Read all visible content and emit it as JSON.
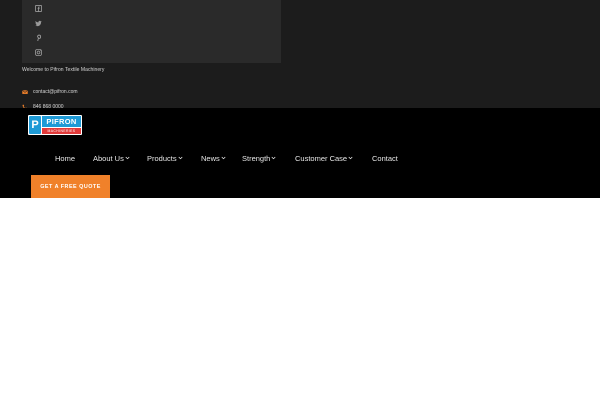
{
  "header": {
    "social": [
      {
        "icon": "facebook-icon"
      },
      {
        "icon": "twitter-icon"
      },
      {
        "icon": "pinterest-icon"
      },
      {
        "icon": "instagram-icon"
      }
    ],
    "welcome_text": "Welcome to Pifron Textile Machinery",
    "email": "contact@pifron.com",
    "phone": "846 868 0000",
    "accent_color": "#f0812a"
  },
  "logo": {
    "mark": "P",
    "name": "PIFRON",
    "tagline": "MACHINERIES"
  },
  "nav": {
    "items": [
      {
        "label": "Home",
        "has_dropdown": false
      },
      {
        "label": "About Us",
        "has_dropdown": true
      },
      {
        "label": "Products",
        "has_dropdown": true
      },
      {
        "label": "News",
        "has_dropdown": true
      },
      {
        "label": "Strength",
        "has_dropdown": true
      },
      {
        "label": "Customer Case",
        "has_dropdown": true
      },
      {
        "label": "Contact",
        "has_dropdown": false
      }
    ],
    "cta_label": "GET A FREE QUOTE"
  }
}
